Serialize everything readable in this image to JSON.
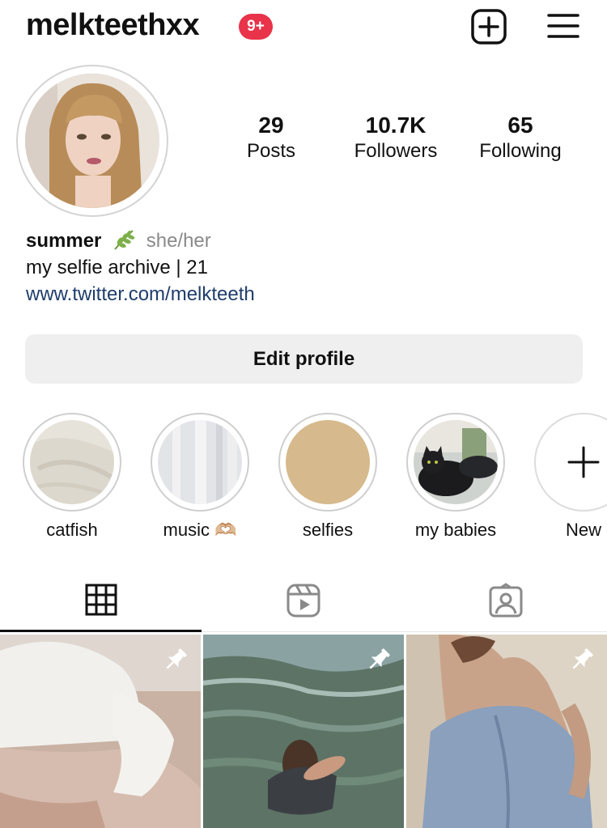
{
  "header": {
    "username": "melkteethxx",
    "notification_badge": "9+",
    "icons": [
      "create-post-icon",
      "menu-icon"
    ]
  },
  "profile": {
    "stats": {
      "posts": {
        "value": "29",
        "label": "Posts"
      },
      "followers": {
        "value": "10.7K",
        "label": "Followers"
      },
      "following": {
        "value": "65",
        "label": "Following"
      }
    },
    "bio": {
      "name": "summer",
      "pronouns": "she/her",
      "line": "my selfie archive | 21",
      "link": "www.twitter.com/melkteeth"
    },
    "edit_button": "Edit profile"
  },
  "highlights": [
    {
      "label": "catfish"
    },
    {
      "label": "music 🫶🏼"
    },
    {
      "label": "selfies"
    },
    {
      "label": "my babies"
    },
    {
      "label": "New"
    }
  ],
  "tabs": [
    "grid-icon",
    "reels-icon",
    "tagged-icon"
  ],
  "colors": {
    "badge": "#e8334a",
    "link": "#1f3d6b",
    "pronouns": "#8a8a8a",
    "button_bg": "#efefef"
  }
}
